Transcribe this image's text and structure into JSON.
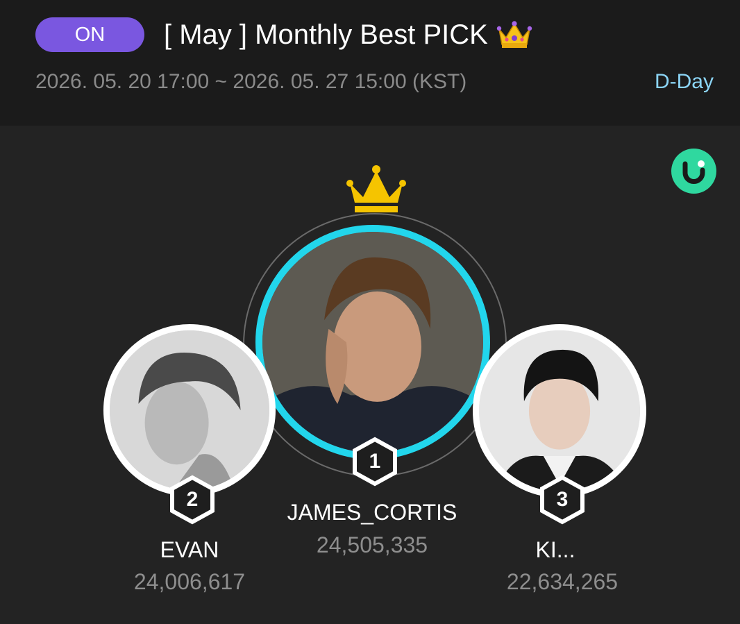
{
  "header": {
    "status_badge": "ON",
    "title": "[ May ] Monthly Best PICK",
    "title_icon": "crown-emoji-icon",
    "period": "2026. 05. 20 17:00 ~ 2026. 05. 27 15:00 (KST)",
    "countdown": "D-Day"
  },
  "brand": {
    "logo_icon": "u-logo-icon",
    "color": "#2fd89f"
  },
  "ranking": [
    {
      "rank": "1",
      "name": "JAMES_CORTIS",
      "votes": "24,505,335",
      "ring_color": "#22d6ec",
      "winner_icon": "gold-crown-icon"
    },
    {
      "rank": "2",
      "name": "EVAN",
      "votes": "24,006,617",
      "ring_color": "#ffffff"
    },
    {
      "rank": "3",
      "name": "KI...",
      "votes": "22,634,265",
      "ring_color": "#ffffff"
    }
  ],
  "colors": {
    "accent_purple": "#7a57e0",
    "highlight_cyan": "#22d6ec",
    "dday_blue": "#8bd4f5",
    "crown_gold": "#f5c400"
  }
}
